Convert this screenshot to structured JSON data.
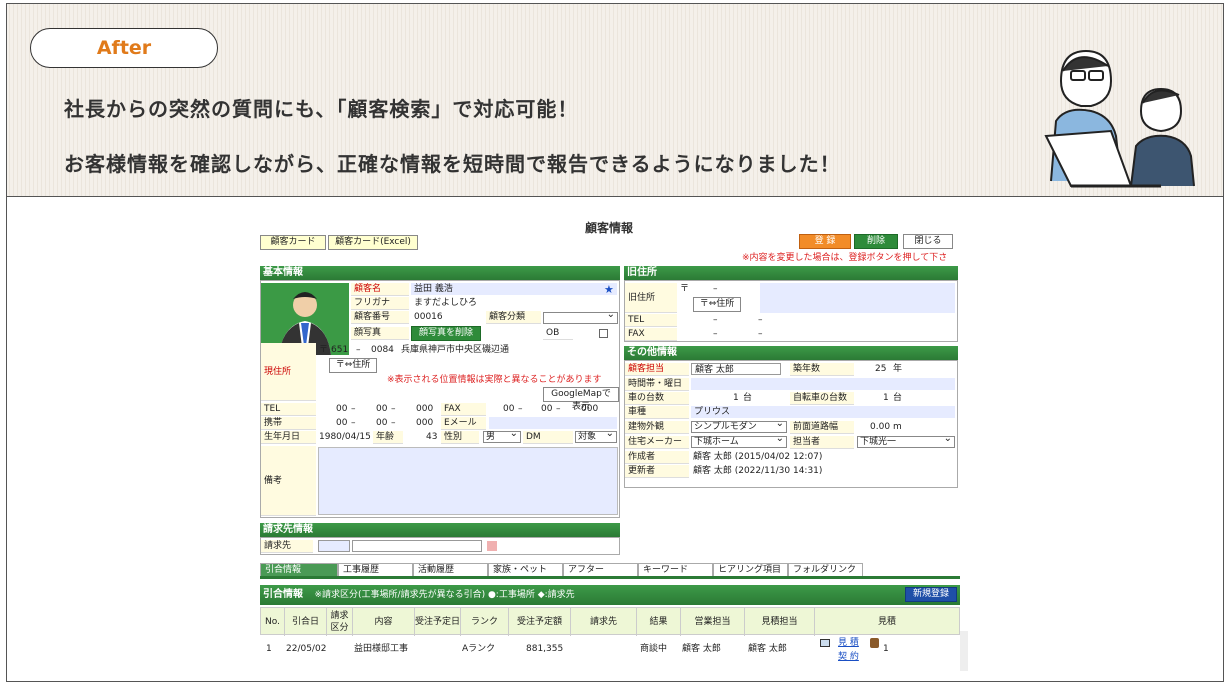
{
  "banner": {
    "tag": "After",
    "line1": "社長からの突然の質問にも、「顧客検索」で対応可能！",
    "line2": "お客様情報を確認しながら、正確な情報を短時間で報告できるようになりました！"
  },
  "app": {
    "title": "顧客情報",
    "buttons": {
      "card": "顧客カード",
      "card_excel": "顧客カード(Excel)",
      "register": "登 録",
      "delete": "削除",
      "close": "閉じる"
    },
    "warning": "※内容を変更した場合は、登録ボタンを押して下さい。",
    "basic": {
      "header": "基本情報",
      "name_label": "顧客名",
      "name": "益田 義浩",
      "star": "★",
      "kana_label": "フリガナ",
      "kana": "ますだよしひろ",
      "number_label": "顧客番号",
      "number": "00016",
      "category_label": "顧客分類",
      "photo_label": "顔写真",
      "photo_delete": "顔写真を削除",
      "ob_label": "OB",
      "address_label": "現住所",
      "postal_mark": "〒",
      "postal1": "651",
      "postal2": "0084",
      "address": "兵庫県神戸市中央区磯辺通",
      "zip_btn": "〒⇔住所",
      "map_note": "※表示される位置情報は実際と異なることがあります",
      "map_btn": "GoogleMapで表示",
      "tel_label": "TEL",
      "tel1": "00",
      "tel2": "00",
      "tel3": "000",
      "fax_label": "FAX",
      "fax1": "00",
      "fax2": "00",
      "fax3": "000",
      "mobile_label": "携帯",
      "mob1": "00",
      "mob2": "00",
      "mob3": "000",
      "email_label": "Eメール",
      "birth_label": "生年月日",
      "birth": "1980/04/15",
      "age_label": "年齢",
      "age": "43",
      "gender_label": "性別",
      "gender": "男",
      "dm_label": "DM",
      "dm": "対象",
      "memo_label": "備考"
    },
    "old_address": {
      "header": "旧住所",
      "label": "旧住所",
      "postal_mark": "〒",
      "zip_btn": "〒⇔住所",
      "tel_label": "TEL",
      "fax_label": "FAX"
    },
    "other": {
      "header": "その他情報",
      "staff_label": "顧客担当",
      "staff": "顧客 太郎",
      "years_label": "築年数",
      "years": "25",
      "years_unit": "年",
      "time_label": "時間帯・曜日",
      "cars_label": "車の台数",
      "cars": "1",
      "cars_unit": "台",
      "bikes_label": "自転車の台数",
      "bikes": "1",
      "bikes_unit": "台",
      "carmodel_label": "車種",
      "carmodel": "プリウス",
      "exterior_label": "建物外観",
      "exterior": "シンプルモダン",
      "road_label": "前面道路幅",
      "road": "0.00",
      "road_unit": "m",
      "maker_label": "住宅メーカー",
      "maker": "下城ホーム",
      "owner_label": "担当者",
      "owner": "下城光一",
      "creator_label": "作成者",
      "creator": "顧客 太郎 (2015/04/02 12:07)",
      "updater_label": "更新者",
      "updater": "顧客 太郎 (2022/11/30 14:31)"
    },
    "billing": {
      "header": "請求先情報",
      "label": "請求先"
    },
    "tabs": [
      "引合情報",
      "工事履歴",
      "活動履歴",
      "家族・ペット",
      "アフター",
      "キーワード",
      "ヒアリング項目",
      "フォルダリンク"
    ],
    "inquiry": {
      "header": "引合情報",
      "note": "※請求区分(工事場所/請求先が異なる引合) ●:工事場所 ◆:請求先",
      "new_btn": "新規登録",
      "columns": [
        "No.",
        "引合日",
        "請求区分",
        "内容",
        "受注予定日",
        "ランク",
        "受注予定額",
        "請求先",
        "結果",
        "営業担当",
        "見積担当",
        "見積"
      ],
      "rows": [
        {
          "no": "1",
          "date": "22/05/02",
          "content": "益田様邸工事",
          "rank": "Aランク",
          "amount": "881,355",
          "result": "商談中",
          "sales": "顧客 太郎",
          "estimator": "顧客 太郎",
          "est": "見 積",
          "contract": "契 約",
          "count": "1"
        }
      ]
    }
  }
}
